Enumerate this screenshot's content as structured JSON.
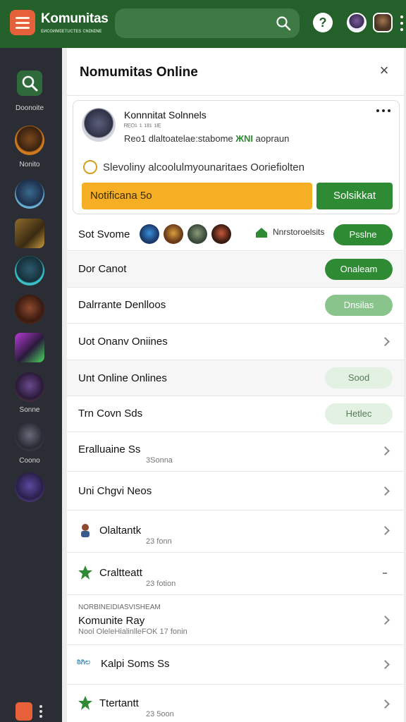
{
  "header": {
    "brand_title": "Komunitas",
    "brand_subtitle": "ᴇᴎᴄᴏᴎᴍɪᴇᴛᴜᴄᴛᴇs ᴄɴɪɴɪɴᴇ",
    "search_placeholder": "",
    "help_label": "?"
  },
  "rail": {
    "items": [
      {
        "label": "Doonoite",
        "color": "#2f6b3a"
      },
      {
        "label": "Nonito",
        "color": "#d07a1e"
      },
      {
        "label": "",
        "color": "#2d5a8e"
      },
      {
        "label": "",
        "color": "#8e6a2d"
      },
      {
        "label": "",
        "color": "#2d8a8e"
      },
      {
        "label": "",
        "color": "#7a3e2d"
      },
      {
        "label": "",
        "color": "#6a2d8e"
      },
      {
        "label": "Sonne",
        "color": "#7a4a2a"
      },
      {
        "label": "Coono",
        "color": "#4a4a5a"
      },
      {
        "label": "",
        "color": "#6a4aa0"
      }
    ]
  },
  "panel": {
    "title": "Nomumitas Online",
    "close_label": "×",
    "profile": {
      "name": "Konnnitat Solnnels",
      "id_line": "ᴿᴱᴼ¹ ¹ ¹ᴵᴵ¹ ¹ᴵᴱ",
      "desc_prefix": "Reo1 dlaltoatelae:stabome ",
      "desc_highlight": "ЖNI",
      "desc_suffix": " aopraun",
      "status": "Slevoliny alcoolulmyounaritaes Ooriefiolten"
    },
    "buttons": {
      "notify": "Notificana 5o",
      "select": "Solsikkat"
    },
    "friends": {
      "label": "Sot Svome",
      "tag": "Nnrstoroelsits",
      "action": "Psslne"
    },
    "rows": [
      {
        "label": "Dor Canot",
        "button": "Onaleam",
        "style": "green"
      },
      {
        "label": "Dalrrante Denlloos",
        "button": "Dnsilas",
        "style": "faded"
      },
      {
        "label": "Uot Onanv Oniines",
        "button": "",
        "style": "chevron"
      },
      {
        "label": "Unt Online Onlines",
        "button": "Sood",
        "style": "pale"
      },
      {
        "label": "Trn Covn Sds",
        "button": "Hetlec",
        "style": "pale-icon"
      },
      {
        "label": "Eralluaine Ss",
        "sub": "3Sonna"
      },
      {
        "label": "Uni Chgvi Neos"
      },
      {
        "label": "Olaltantk",
        "sub": "23 fonn"
      },
      {
        "label": "Craltteatt",
        "sub": "23 fotion"
      },
      {
        "kicker": "NORBINEIDIASVISHEAM",
        "label": "Komunite Ray",
        "sub": "Nool OleleHialinlleFOK 17 fonin"
      },
      {
        "label": "Kalpi Soms Ss",
        "badge": "ಠಿಗಿಲ"
      },
      {
        "label": "Ttertantt",
        "sub": "23 5oon"
      }
    ]
  },
  "colors": {
    "brand_green": "#24602a",
    "accent_green": "#2f8a34",
    "accent_orange": "#f6ae24",
    "rail_bg": "#2a2d33",
    "logo_orange": "#e6613a"
  }
}
